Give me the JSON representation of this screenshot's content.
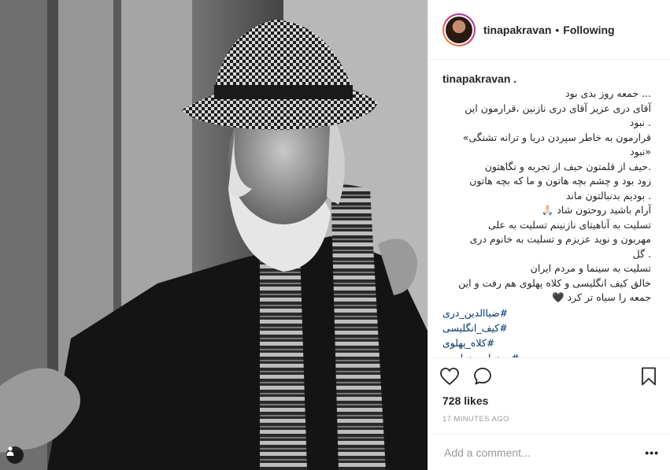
{
  "post": {
    "photo_alt": "",
    "tag_icon": "person-tag-icon"
  },
  "header": {
    "username": "tinapakravan",
    "separator": "•",
    "follow_label": "Following"
  },
  "caption": {
    "username": "tinapakravan .",
    "lines": [
      "... جمعه روز بدی بود",
      "آقای دری عزیز آقای دری نازنین ،قرارمون این",
      ". نبود",
      "قرارمون به خاطر سپردن دریا و ترانه تشنگی»",
      "«نبود",
      ".حیف از قلمتون حیف از تجربه و نگاهتون",
      "زود بود و چشم بچه هاتون و ما که بچه هاتون",
      ". بودیم بدنبالتون ماند",
      "آرام باشید روحتون شاد 🙏🏻",
      "تسلیت به آناهیتای نازنینم تسلیت به علی",
      "مهربون و نوید عزیزم و تسلیت به خانوم دری",
      ". گل",
      "تسلیت به سینما و مردم ایران",
      "خالق کیف انگلیسی و کلاه پهلوی هم رفت و این",
      "جمعه را سیاه تر کرد 🖤"
    ],
    "hashtags": [
      "#ضیاالدین_دری",
      "#کیف_انگلیسی",
      "#کلاه_پهلوی",
      "#سینما_سینماست"
    ]
  },
  "actions": {
    "like_icon": "heart-icon",
    "comment_icon": "comment-icon",
    "save_icon": "bookmark-icon"
  },
  "likes": "728 likes",
  "timestamp": "17 MINUTES AGO",
  "comment_box": {
    "placeholder": "Add a comment...",
    "more_label": "•••"
  },
  "colors": {
    "link": "#003569",
    "muted": "#999999",
    "border": "#efefef",
    "text": "#262626"
  }
}
